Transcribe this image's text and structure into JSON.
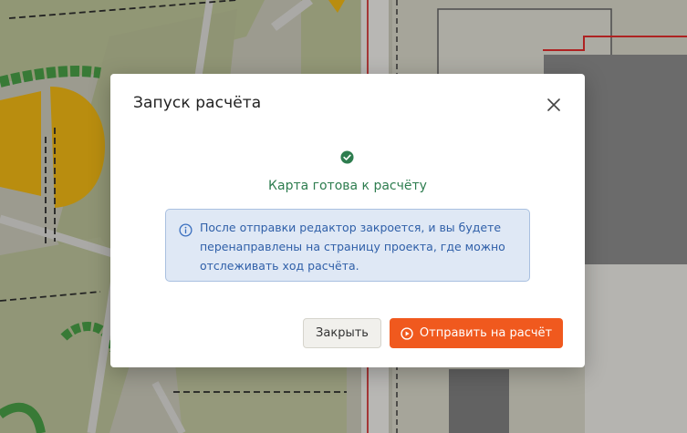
{
  "modal": {
    "title": "Запуск расчёта",
    "status_text": "Карта готова к расчёту",
    "info_text": "После отправки редактор закроется, и вы будете перенаправлены на страницу проекта, где можно отслеживать ход расчёта.",
    "close_label": "Закрыть",
    "submit_label": "Отправить на расчёт"
  },
  "icons": {
    "close": "close-icon",
    "status": "check-circle-icon",
    "info": "info-icon",
    "submit": "play-circle-icon"
  },
  "colors": {
    "accent": "#f0591e",
    "success": "#2e7d4f",
    "info_bg": "#dfe8f5",
    "info_border": "#a9c0e0",
    "info_text": "#2f5fa8"
  }
}
